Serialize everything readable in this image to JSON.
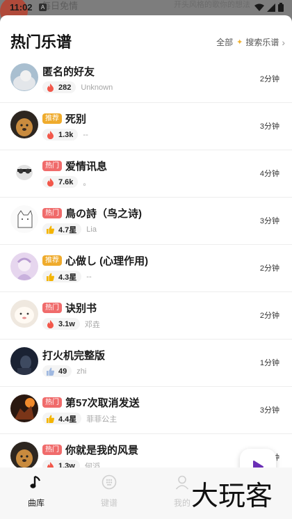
{
  "status_bar": {
    "time": "11:02",
    "notification_badge": "A"
  },
  "background": {
    "title": "每日免情",
    "text": "开头风格的歌你的想法"
  },
  "sheet": {
    "title": "热门乐谱",
    "all_label": "全部",
    "search_label": "搜索乐谱"
  },
  "songs": [
    {
      "title": "匿名的好友",
      "tag": "",
      "metric": "282",
      "metric_icon": "flame-icon",
      "author": "Unknown",
      "duration": "2分钟"
    },
    {
      "title": "死别",
      "tag": "推荐",
      "tag_type": "rec",
      "metric": "1.3k",
      "metric_icon": "flame-icon",
      "author": "--",
      "duration": "3分钟"
    },
    {
      "title": "爱情讯息",
      "tag": "热门",
      "tag_type": "hot",
      "metric": "7.6k",
      "metric_icon": "flame-icon",
      "author": "。",
      "duration": "4分钟"
    },
    {
      "title": "鳥の詩（鸟之诗)",
      "tag": "热门",
      "tag_type": "hot",
      "metric": "4.7星",
      "metric_icon": "thumbs-up-icon",
      "author": "Lia",
      "duration": "3分钟"
    },
    {
      "title": "心做し (心理作用)",
      "tag": "推荐",
      "tag_type": "rec",
      "metric": "4.3星",
      "metric_icon": "thumbs-up-icon",
      "author": "--",
      "duration": "2分钟"
    },
    {
      "title": "诀别书",
      "tag": "热门",
      "tag_type": "hot",
      "metric": "3.1w",
      "metric_icon": "flame-icon",
      "author": "邓垚",
      "duration": "2分钟"
    },
    {
      "title": "打火机完整版",
      "tag": "",
      "metric": "49",
      "metric_icon": "thumbs-up-icon",
      "author": "zhi",
      "duration": "1分钟"
    },
    {
      "title": "第57次取消发送",
      "tag": "热门",
      "tag_type": "hot",
      "metric": "4.4星",
      "metric_icon": "thumbs-up-icon",
      "author": "菲菲公主",
      "duration": "3分钟"
    },
    {
      "title": "你就是我的风景",
      "tag": "热门",
      "tag_type": "hot",
      "metric": "1.3w",
      "metric_icon": "flame-icon",
      "author": "何滔",
      "duration": "3分钟"
    }
  ],
  "bottom_nav": [
    {
      "label": "曲库",
      "icon": "music-note-icon",
      "active": true
    },
    {
      "label": "键谱",
      "icon": "keypad-icon",
      "active": false
    },
    {
      "label": "我的",
      "icon": "user-icon",
      "active": false
    }
  ],
  "watermark": "大玩客",
  "colors": {
    "hot_tag": "#f06b6b",
    "recommend_tag": "#efab2c",
    "play_accent": "#6a2fb5",
    "flame": "#f2574a",
    "thumbs": "#f4b400",
    "thumbs_low": "#9fb8e0"
  }
}
